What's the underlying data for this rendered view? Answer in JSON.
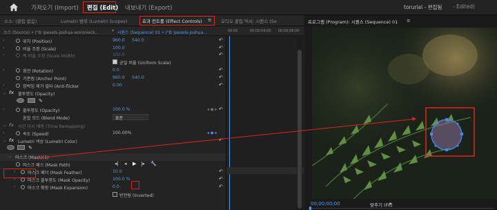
{
  "app": {
    "home_icon": "home-icon",
    "tabs": [
      {
        "label": "가져오기 (Import)"
      },
      {
        "label": "편집 (Edit)"
      },
      {
        "label": "내보내기 (Export)"
      }
    ],
    "project_title": "torurial - 편집됨",
    "project_status": "- Edited)"
  },
  "effect_panel": {
    "tabs": [
      {
        "label": "소스: (클립 없음)"
      },
      {
        "label": "Lumetri 범위 (Lumetri Scopes)"
      },
      {
        "label": "효과 컨트롤 (Effect Controls)"
      },
      {
        "label": "오디오 클립 믹서: 시퀀스 (Se"
      }
    ],
    "menu_icon": "≡",
    "source_label": "소스 (Source) • (\"B )pexels-joshua-woronieck...",
    "sequence_label": "시퀀스 (Sequence) 01 • (\"B )pexels-joshua...",
    "timecodes": [
      "00:00",
      "00;00;04;00",
      "00;00;08;00"
    ],
    "rows": [
      {
        "name": "위치 (Position)",
        "v1": "960.0",
        "v2": "540.0"
      },
      {
        "name": "비율 조정 (Scale)",
        "v1": "100.0"
      },
      {
        "name": "폭 비율 조정 (Scale Width)",
        "v1": "100.0"
      },
      {
        "checkbox_label": "균일 비율 (Uniform Scale)"
      },
      {
        "name": "회전 (Rotation)",
        "v1": "0.0"
      },
      {
        "name": "기준점 (Anchor Point)",
        "v1": "960.0",
        "v2": "540.0"
      },
      {
        "name": "깜박임 제거 필터 (Anti-flicker",
        "v1": "0.00"
      },
      {
        "name": "불투명도 (Opacity)"
      },
      {
        "name": "불투명도 (Opacity)",
        "v1": "100.0 %"
      },
      {
        "name": "혼합 모드 (Blend Mode)",
        "select": "표준"
      },
      {
        "name": "시간 다시 매핑 (Time Remapping)"
      },
      {
        "name": "속도 (Speed)",
        "v1": "100.00%"
      },
      {
        "name": "Lumetri 색상 (Lumetri Color)"
      },
      {
        "name": "마스크 (Mask)(1)"
      },
      {
        "name": "마스크 패스 (Mask Path)"
      },
      {
        "name": "마스크 페더 (Mask Feather)",
        "v1": "10.0"
      },
      {
        "name": "마스크 불투명도 (Mask Opacity)",
        "v1": "100.0 %"
      },
      {
        "name": "마스크 확장 (Mask Expansion)",
        "v1": "0.0"
      },
      {
        "checkbox_label": "반전됨 (Inverted)"
      }
    ]
  },
  "program_monitor": {
    "title": "프로그램 (Program): 시퀀스 (Sequence) 01",
    "menu_icon": "≡",
    "timecode": "00;00;00;00",
    "fit_label": "맞추기 (Fit)",
    "fit_arrow": "▾"
  },
  "colors": {
    "accent_blue": "#4d9cf2",
    "highlight_red": "#e2241f",
    "panel_bg": "#232323"
  }
}
